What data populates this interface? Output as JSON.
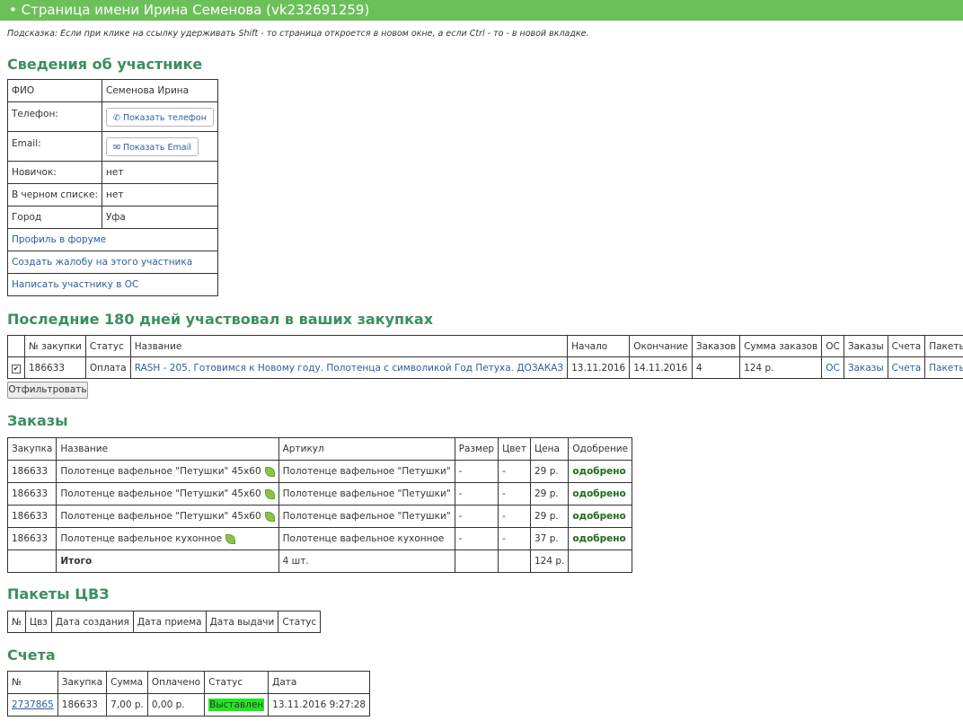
{
  "header": {
    "title": "• Страница имени Ирина Семенова (vk232691259)"
  },
  "hint": "Подсказка: Если при клике на ссылку удерживать Shift - то страница откроется в новом окне, а если Ctrl - то - в новой вкладке.",
  "member": {
    "heading": "Сведения об участнике",
    "fio_label": "ФИО",
    "fio": "Семенова Ирина",
    "phone_label": "Телефон:",
    "phone_btn": "Показать телефон",
    "email_label": "Email:",
    "email_btn": "Показать Email",
    "newbie_label": "Новичок:",
    "newbie": "нет",
    "black_label": "В черном списке:",
    "black": "нет",
    "city_label": "Город",
    "city": "Уфа",
    "forum_link": "Профиль в форуме",
    "complaint_link": "Создать жалобу на этого участника",
    "write_link": "Написать участнику в ОС"
  },
  "purchases": {
    "heading": "Последние 180 дней участвовал в ваших закупках",
    "columns": [
      "",
      "№ закупки",
      "Статус",
      "Название",
      "Начало",
      "Окончание",
      "Заказов",
      "Сумма заказов",
      "ОС",
      "Заказы",
      "Счета",
      "Пакеты"
    ],
    "row": {
      "id": "186633",
      "status": "Оплата",
      "name": "RASH - 205. Готовимся к Новому году. Полотенца с символикой Год Петуха. ДОЗАКАЗ",
      "start": "13.11.2016",
      "end": "14.11.2016",
      "orders": "4",
      "sum": "124 р.",
      "os": "ОС",
      "orders_link": "Заказы",
      "bills_link": "Счета",
      "packets_link": "Пакеты"
    },
    "filter_btn": "Отфильтровать"
  },
  "orders": {
    "heading": "Заказы",
    "columns": [
      "Закупка",
      "Название",
      "Артикул",
      "Размер",
      "Цвет",
      "Цена",
      "Одобрение"
    ],
    "rows": [
      {
        "purchase": "186633",
        "name": "Полотенце вафельное \"Петушки\" 45х60",
        "article": "Полотенце вафельное \"Петушки\"",
        "size": "-",
        "color": "-",
        "price": "29 р.",
        "approval": "одобрено"
      },
      {
        "purchase": "186633",
        "name": "Полотенце вафельное \"Петушки\" 45х60",
        "article": "Полотенце вафельное \"Петушки\"",
        "size": "-",
        "color": "-",
        "price": "29 р.",
        "approval": "одобрено"
      },
      {
        "purchase": "186633",
        "name": "Полотенце вафельное \"Петушки\" 45х60",
        "article": "Полотенце вафельное \"Петушки\"",
        "size": "-",
        "color": "-",
        "price": "29 р.",
        "approval": "одобрено"
      },
      {
        "purchase": "186633",
        "name": "Полотенце вафельное кухонное",
        "article": "Полотенце вафельное кухонное",
        "size": "-",
        "color": "-",
        "price": "37 р.",
        "approval": "одобрено"
      }
    ],
    "total_label": "Итого",
    "total_qty": "4 шт.",
    "total_sum": "124 р."
  },
  "packets": {
    "heading": "Пакеты ЦВЗ",
    "columns": [
      "№",
      "Цвз",
      "Дата создания",
      "Дата приема",
      "Дата выдачи",
      "Статус"
    ]
  },
  "bills": {
    "heading": "Счета",
    "columns": [
      "№",
      "Закупка",
      "Сумма",
      "Оплачено",
      "Статус",
      "Дата"
    ],
    "row": {
      "num": "2737865",
      "purchase": "186633",
      "sum": "7,00 р.",
      "paid": "0,00 р.",
      "status": "Выставлен",
      "date": "13.11.2016 9:27:28"
    }
  }
}
